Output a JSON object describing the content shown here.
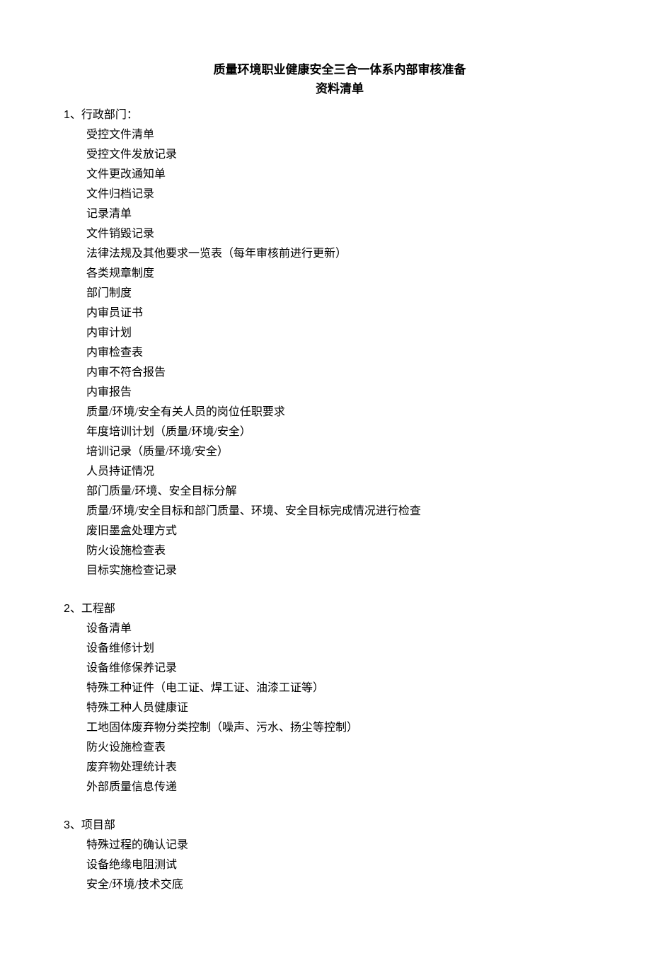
{
  "title_line1": "质量环境职业健康安全三合一体系内部审核准备",
  "title_line2": "资料清单",
  "sections": [
    {
      "number": "1",
      "name": "行政部门：",
      "items": [
        "受控文件清单",
        "受控文件发放记录",
        "文件更改通知单",
        "文件归档记录",
        "记录清单",
        "文件销毁记录",
        "法律法规及其他要求一览表（每年审核前进行更新）",
        "各类规章制度",
        "部门制度",
        "内审员证书",
        "内审计划",
        "内审检查表",
        "内审不符合报告",
        "内审报告",
        "质量/环境/安全有关人员的岗位任职要求",
        "年度培训计划（质量/环境/安全）",
        "培训记录（质量/环境/安全）",
        "人员持证情况",
        "部门质量/环境、安全目标分解",
        "质量/环境/安全目标和部门质量、环境、安全目标完成情况进行检查",
        "废旧墨盒处理方式",
        "防火设施检查表",
        "目标实施检查记录"
      ]
    },
    {
      "number": "2",
      "name": "工程部",
      "items": [
        "设备清单",
        "设备维修计划",
        "设备维修保养记录",
        "特殊工种证件（电工证、焊工证、油漆工证等）",
        "特殊工种人员健康证",
        "工地固体废弃物分类控制（噪声、污水、扬尘等控制）",
        "防火设施检查表",
        "废弃物处理统计表",
        "外部质量信息传递"
      ]
    },
    {
      "number": "3",
      "name": "项目部",
      "items": [
        "特殊过程的确认记录",
        "设备绝缘电阻测试",
        "安全/环境/技术交底"
      ]
    }
  ]
}
